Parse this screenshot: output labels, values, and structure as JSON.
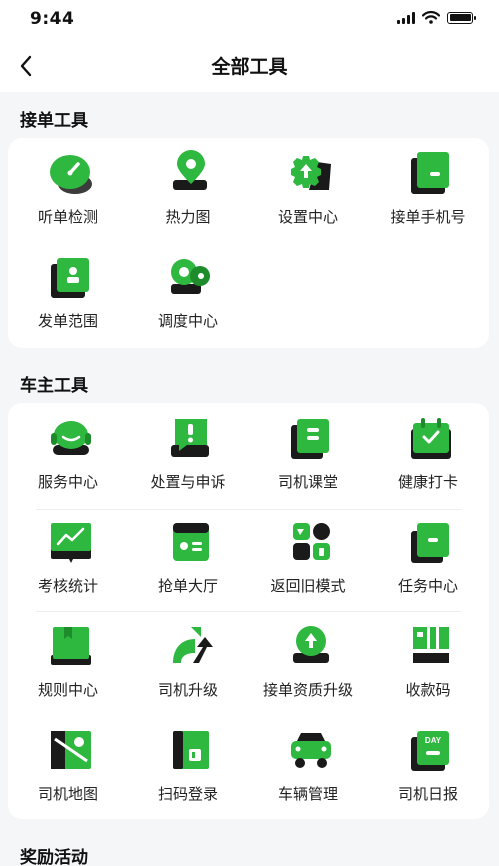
{
  "status_bar": {
    "time": "9:44"
  },
  "header": {
    "title": "全部工具"
  },
  "sections": {
    "order_tools": {
      "title": "接单工具",
      "items": [
        {
          "label": "听单检测",
          "icon": "gauge-icon"
        },
        {
          "label": "热力图",
          "icon": "location-pin-icon"
        },
        {
          "label": "设置中心",
          "icon": "settings-gear-icon"
        },
        {
          "label": "接单手机号",
          "icon": "phone-book-icon"
        },
        {
          "label": "发单范围",
          "icon": "range-card-icon"
        },
        {
          "label": "调度中心",
          "icon": "dispatch-icon"
        }
      ]
    },
    "owner_tools": {
      "title": "车主工具",
      "items": [
        {
          "label": "服务中心",
          "icon": "headset-icon"
        },
        {
          "label": "处置与申诉",
          "icon": "appeal-alert-icon"
        },
        {
          "label": "司机课堂",
          "icon": "classroom-book-icon"
        },
        {
          "label": "健康打卡",
          "icon": "calendar-check-icon"
        },
        {
          "label": "考核统计",
          "icon": "stats-board-icon"
        },
        {
          "label": "抢单大厅",
          "icon": "order-hall-icon"
        },
        {
          "label": "返回旧模式",
          "icon": "old-mode-grid-icon"
        },
        {
          "label": "任务中心",
          "icon": "task-folder-icon"
        },
        {
          "label": "规则中心",
          "icon": "rules-book-icon"
        },
        {
          "label": "司机升级",
          "icon": "upgrade-arrow-icon"
        },
        {
          "label": "接单资质升级",
          "icon": "qualification-badge-icon"
        },
        {
          "label": "收款码",
          "icon": "qr-code-icon"
        },
        {
          "label": "司机地图",
          "icon": "map-icon"
        },
        {
          "label": "扫码登录",
          "icon": "scan-login-icon"
        },
        {
          "label": "车辆管理",
          "icon": "car-icon"
        },
        {
          "label": "司机日报",
          "icon": "daily-report-icon"
        }
      ]
    },
    "rewards": {
      "title": "奖励活动"
    }
  },
  "daily_report_badge": "DAY",
  "colors": {
    "accent_green": "#2eb83f",
    "dark_green": "#1f8c2c",
    "page_bg": "#f5f6f7",
    "card_bg": "#ffffff"
  }
}
